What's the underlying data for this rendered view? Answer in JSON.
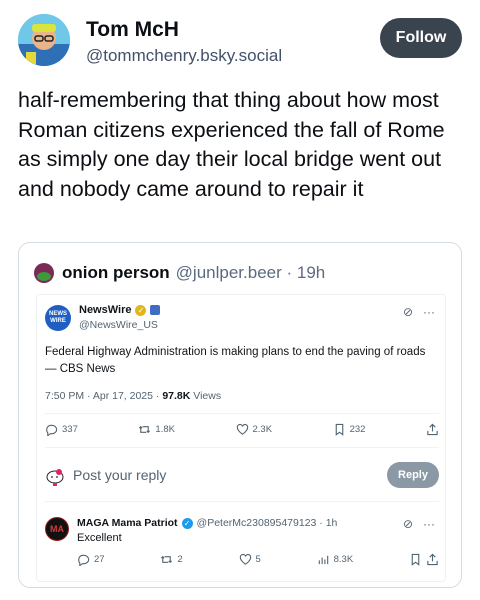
{
  "post": {
    "author_name": "Tom McH",
    "author_handle": "@tommchenry.bsky.social",
    "follow_label": "Follow",
    "text": "half-remembering that thing about how most Roman citizens experienced the fall of Rome as  simply one day their local bridge went out and nobody came around to repair it"
  },
  "quote": {
    "author_name": "onion person",
    "author_meta": "@junlper.beer · 19h",
    "screenshot": {
      "account_logo_text": "NEWS WIRE",
      "account_name": "NewsWire",
      "account_handle": "@NewsWire_US",
      "text": "Federal Highway Administration is making plans to end the paving of roads — CBS News",
      "time": "7:50 PM · Apr 17, 2025 · ",
      "views_count": "97.8K",
      "views_label": " Views",
      "actions": {
        "replies": "337",
        "reposts": "1.8K",
        "likes": "2.3K",
        "bookmarks": "232"
      },
      "reply_placeholder": "Post your reply",
      "reply_button": "Reply",
      "reply": {
        "avatar_text": "MA",
        "name": "MAGA Mama Patriot",
        "meta": "@PeterMc230895479123 · 1h",
        "text": "Excellent",
        "actions": {
          "replies": "27",
          "reposts": "2",
          "likes": "5",
          "views": "8.3K"
        }
      }
    }
  },
  "icons": [
    "reply-icon",
    "repost-icon",
    "like-icon",
    "bookmark-icon",
    "share-icon",
    "views-icon",
    "grok-icon",
    "more-icon",
    "verified-icon"
  ],
  "colors": {
    "follow_bg": "#3a444f",
    "gold_verified": "#e2b719",
    "blue_verified": "#1d9bf0",
    "reply_btn": "#8b98a5"
  }
}
